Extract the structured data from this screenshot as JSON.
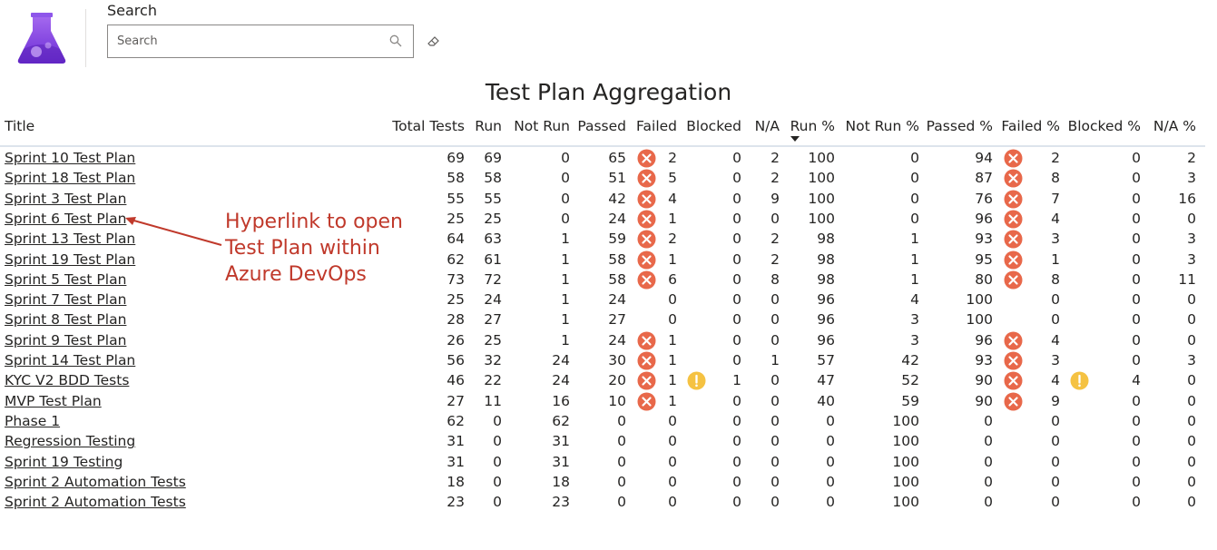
{
  "search": {
    "label": "Search",
    "placeholder": "Search",
    "value": ""
  },
  "report": {
    "title": "Test Plan Aggregation"
  },
  "columns": [
    "Title",
    "Total Tests",
    "Run",
    "Not Run",
    "Passed",
    "Failed",
    "Blocked",
    "N/A",
    "Run %",
    "Not Run %",
    "Passed %",
    "Failed %",
    "Blocked %",
    "N/A %"
  ],
  "sort": {
    "column": "Run %",
    "direction": "descending"
  },
  "rows": [
    {
      "title": "Sprint 10 Test Plan",
      "total": "69",
      "run": "69",
      "not_run": "0",
      "passed": "65",
      "failed_icon": "error",
      "failed": "2",
      "blocked_icon": "",
      "blocked": "0",
      "na": "2",
      "run_pct": "100",
      "not_run_pct": "0",
      "passed_pct": "94",
      "failed_pct_icon": "error",
      "failed_pct": "2",
      "blocked_pct_icon": "",
      "blocked_pct": "0",
      "na_pct": "2"
    },
    {
      "title": "Sprint 18 Test Plan",
      "total": "58",
      "run": "58",
      "not_run": "0",
      "passed": "51",
      "failed_icon": "error",
      "failed": "5",
      "blocked_icon": "",
      "blocked": "0",
      "na": "2",
      "run_pct": "100",
      "not_run_pct": "0",
      "passed_pct": "87",
      "failed_pct_icon": "error",
      "failed_pct": "8",
      "blocked_pct_icon": "",
      "blocked_pct": "0",
      "na_pct": "3"
    },
    {
      "title": "Sprint 3 Test Plan",
      "total": "55",
      "run": "55",
      "not_run": "0",
      "passed": "42",
      "failed_icon": "error",
      "failed": "4",
      "blocked_icon": "",
      "blocked": "0",
      "na": "9",
      "run_pct": "100",
      "not_run_pct": "0",
      "passed_pct": "76",
      "failed_pct_icon": "error",
      "failed_pct": "7",
      "blocked_pct_icon": "",
      "blocked_pct": "0",
      "na_pct": "16"
    },
    {
      "title": "Sprint 6 Test Plan",
      "total": "25",
      "run": "25",
      "not_run": "0",
      "passed": "24",
      "failed_icon": "error",
      "failed": "1",
      "blocked_icon": "",
      "blocked": "0",
      "na": "0",
      "run_pct": "100",
      "not_run_pct": "0",
      "passed_pct": "96",
      "failed_pct_icon": "error",
      "failed_pct": "4",
      "blocked_pct_icon": "",
      "blocked_pct": "0",
      "na_pct": "0"
    },
    {
      "title": "Sprint 13 Test Plan",
      "total": "64",
      "run": "63",
      "not_run": "1",
      "passed": "59",
      "failed_icon": "error",
      "failed": "2",
      "blocked_icon": "",
      "blocked": "0",
      "na": "2",
      "run_pct": "98",
      "not_run_pct": "1",
      "passed_pct": "93",
      "failed_pct_icon": "error",
      "failed_pct": "3",
      "blocked_pct_icon": "",
      "blocked_pct": "0",
      "na_pct": "3"
    },
    {
      "title": "Sprint 19 Test Plan",
      "total": "62",
      "run": "61",
      "not_run": "1",
      "passed": "58",
      "failed_icon": "error",
      "failed": "1",
      "blocked_icon": "",
      "blocked": "0",
      "na": "2",
      "run_pct": "98",
      "not_run_pct": "1",
      "passed_pct": "95",
      "failed_pct_icon": "error",
      "failed_pct": "1",
      "blocked_pct_icon": "",
      "blocked_pct": "0",
      "na_pct": "3"
    },
    {
      "title": "Sprint 5 Test Plan",
      "total": "73",
      "run": "72",
      "not_run": "1",
      "passed": "58",
      "failed_icon": "error",
      "failed": "6",
      "blocked_icon": "",
      "blocked": "0",
      "na": "8",
      "run_pct": "98",
      "not_run_pct": "1",
      "passed_pct": "80",
      "failed_pct_icon": "error",
      "failed_pct": "8",
      "blocked_pct_icon": "",
      "blocked_pct": "0",
      "na_pct": "11"
    },
    {
      "title": "Sprint 7 Test Plan",
      "total": "25",
      "run": "24",
      "not_run": "1",
      "passed": "24",
      "failed_icon": "",
      "failed": "0",
      "blocked_icon": "",
      "blocked": "0",
      "na": "0",
      "run_pct": "96",
      "not_run_pct": "4",
      "passed_pct": "100",
      "failed_pct_icon": "",
      "failed_pct": "0",
      "blocked_pct_icon": "",
      "blocked_pct": "0",
      "na_pct": "0"
    },
    {
      "title": "Sprint 8 Test Plan",
      "total": "28",
      "run": "27",
      "not_run": "1",
      "passed": "27",
      "failed_icon": "",
      "failed": "0",
      "blocked_icon": "",
      "blocked": "0",
      "na": "0",
      "run_pct": "96",
      "not_run_pct": "3",
      "passed_pct": "100",
      "failed_pct_icon": "",
      "failed_pct": "0",
      "blocked_pct_icon": "",
      "blocked_pct": "0",
      "na_pct": "0"
    },
    {
      "title": "Sprint 9 Test Plan",
      "total": "26",
      "run": "25",
      "not_run": "1",
      "passed": "24",
      "failed_icon": "error",
      "failed": "1",
      "blocked_icon": "",
      "blocked": "0",
      "na": "0",
      "run_pct": "96",
      "not_run_pct": "3",
      "passed_pct": "96",
      "failed_pct_icon": "error",
      "failed_pct": "4",
      "blocked_pct_icon": "",
      "blocked_pct": "0",
      "na_pct": "0"
    },
    {
      "title": "Sprint 14 Test Plan",
      "total": "56",
      "run": "32",
      "not_run": "24",
      "passed": "30",
      "failed_icon": "error",
      "failed": "1",
      "blocked_icon": "",
      "blocked": "0",
      "na": "1",
      "run_pct": "57",
      "not_run_pct": "42",
      "passed_pct": "93",
      "failed_pct_icon": "error",
      "failed_pct": "3",
      "blocked_pct_icon": "",
      "blocked_pct": "0",
      "na_pct": "3"
    },
    {
      "title": "KYC V2 BDD Tests",
      "total": "46",
      "run": "22",
      "not_run": "24",
      "passed": "20",
      "failed_icon": "error",
      "failed": "1",
      "blocked_icon": "warning",
      "blocked": "1",
      "na": "0",
      "run_pct": "47",
      "not_run_pct": "52",
      "passed_pct": "90",
      "failed_pct_icon": "error",
      "failed_pct": "4",
      "blocked_pct_icon": "warning",
      "blocked_pct": "4",
      "na_pct": "0"
    },
    {
      "title": "MVP Test Plan",
      "total": "27",
      "run": "11",
      "not_run": "16",
      "passed": "10",
      "failed_icon": "error",
      "failed": "1",
      "blocked_icon": "",
      "blocked": "0",
      "na": "0",
      "run_pct": "40",
      "not_run_pct": "59",
      "passed_pct": "90",
      "failed_pct_icon": "error",
      "failed_pct": "9",
      "blocked_pct_icon": "",
      "blocked_pct": "0",
      "na_pct": "0"
    },
    {
      "title": "Phase 1",
      "total": "62",
      "run": "0",
      "not_run": "62",
      "passed": "0",
      "failed_icon": "",
      "failed": "0",
      "blocked_icon": "",
      "blocked": "0",
      "na": "0",
      "run_pct": "0",
      "not_run_pct": "100",
      "passed_pct": "0",
      "failed_pct_icon": "",
      "failed_pct": "0",
      "blocked_pct_icon": "",
      "blocked_pct": "0",
      "na_pct": "0"
    },
    {
      "title": "Regression Testing",
      "total": "31",
      "run": "0",
      "not_run": "31",
      "passed": "0",
      "failed_icon": "",
      "failed": "0",
      "blocked_icon": "",
      "blocked": "0",
      "na": "0",
      "run_pct": "0",
      "not_run_pct": "100",
      "passed_pct": "0",
      "failed_pct_icon": "",
      "failed_pct": "0",
      "blocked_pct_icon": "",
      "blocked_pct": "0",
      "na_pct": "0"
    },
    {
      "title": "Sprint 19 Testing",
      "total": "31",
      "run": "0",
      "not_run": "31",
      "passed": "0",
      "failed_icon": "",
      "failed": "0",
      "blocked_icon": "",
      "blocked": "0",
      "na": "0",
      "run_pct": "0",
      "not_run_pct": "100",
      "passed_pct": "0",
      "failed_pct_icon": "",
      "failed_pct": "0",
      "blocked_pct_icon": "",
      "blocked_pct": "0",
      "na_pct": "0"
    },
    {
      "title": "Sprint 2 Automation Tests",
      "total": "18",
      "run": "0",
      "not_run": "18",
      "passed": "0",
      "failed_icon": "",
      "failed": "0",
      "blocked_icon": "",
      "blocked": "0",
      "na": "0",
      "run_pct": "0",
      "not_run_pct": "100",
      "passed_pct": "0",
      "failed_pct_icon": "",
      "failed_pct": "0",
      "blocked_pct_icon": "",
      "blocked_pct": "0",
      "na_pct": "0"
    },
    {
      "title": "Sprint 2 Automation Tests",
      "total": "23",
      "run": "0",
      "not_run": "23",
      "passed": "0",
      "failed_icon": "",
      "failed": "0",
      "blocked_icon": "",
      "blocked": "0",
      "na": "0",
      "run_pct": "0",
      "not_run_pct": "100",
      "passed_pct": "0",
      "failed_pct_icon": "",
      "failed_pct": "0",
      "blocked_pct_icon": "",
      "blocked_pct": "0",
      "na_pct": "0"
    }
  ],
  "annotation": {
    "lines": [
      "Hyperlink to open",
      "Test Plan within",
      "Azure DevOps"
    ]
  },
  "colors": {
    "error": "#e8684a",
    "warning": "#f5c242",
    "annotation": "#c0392b",
    "logo": "#7b3fe4"
  },
  "icons": {
    "error": "error-x-icon",
    "warning": "warning-exclamation-icon",
    "search": "search-icon",
    "clear": "eraser-icon",
    "logo": "test-plans-flask-icon"
  }
}
